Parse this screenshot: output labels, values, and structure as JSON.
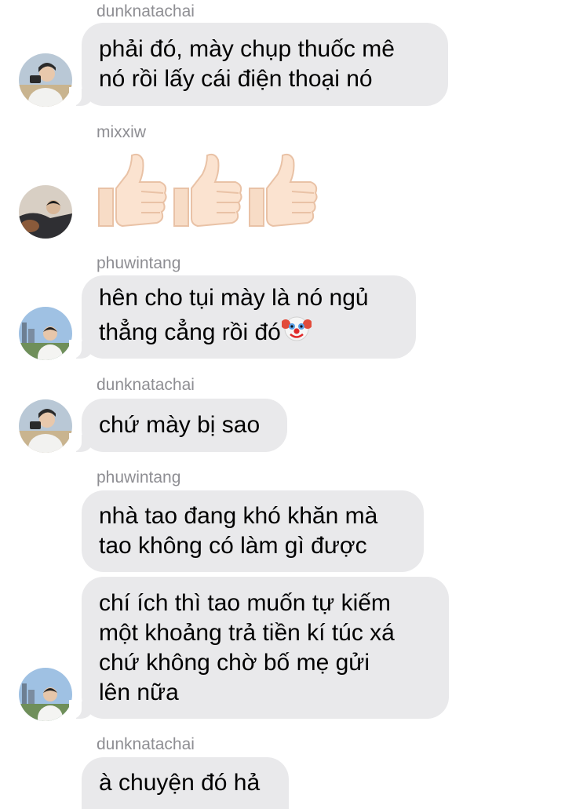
{
  "messages": [
    {
      "sender": "dunknatachai",
      "text": "phải đó, mày chụp thuốc mê\nnó rồi lấy cái điện thoại nó",
      "avatar": "avatar-camera-photo"
    },
    {
      "sender": "mixxiw",
      "emoji": "thumbs-up-icon x3",
      "avatar": "avatar-dark-photo"
    },
    {
      "sender": "phuwintang",
      "text": "hên cho tụi mày là nó ngủ\nthẳng cẳng rồi đó",
      "trailing_emoji": "clown-face-icon",
      "avatar": "avatar-city-photo"
    },
    {
      "sender": "dunknatachai",
      "text": "chứ mày bị sao",
      "avatar": "avatar-camera-photo"
    },
    {
      "sender": "phuwintang",
      "text": "nhà tao đang khó khăn mà\ntao không có làm gì được"
    },
    {
      "text": "chí ích thì tao muốn tự kiếm\nmột khoảng trả tiền kí túc xá\nchứ không chờ bố mẹ gửi\nlên nữa",
      "avatar": "avatar-city-photo"
    },
    {
      "sender": "dunknatachai",
      "text": "à chuyện đó hả"
    }
  ],
  "colors": {
    "bubble": "#e9e9eb",
    "sender": "#8e8e93",
    "background": "#ffffff"
  }
}
